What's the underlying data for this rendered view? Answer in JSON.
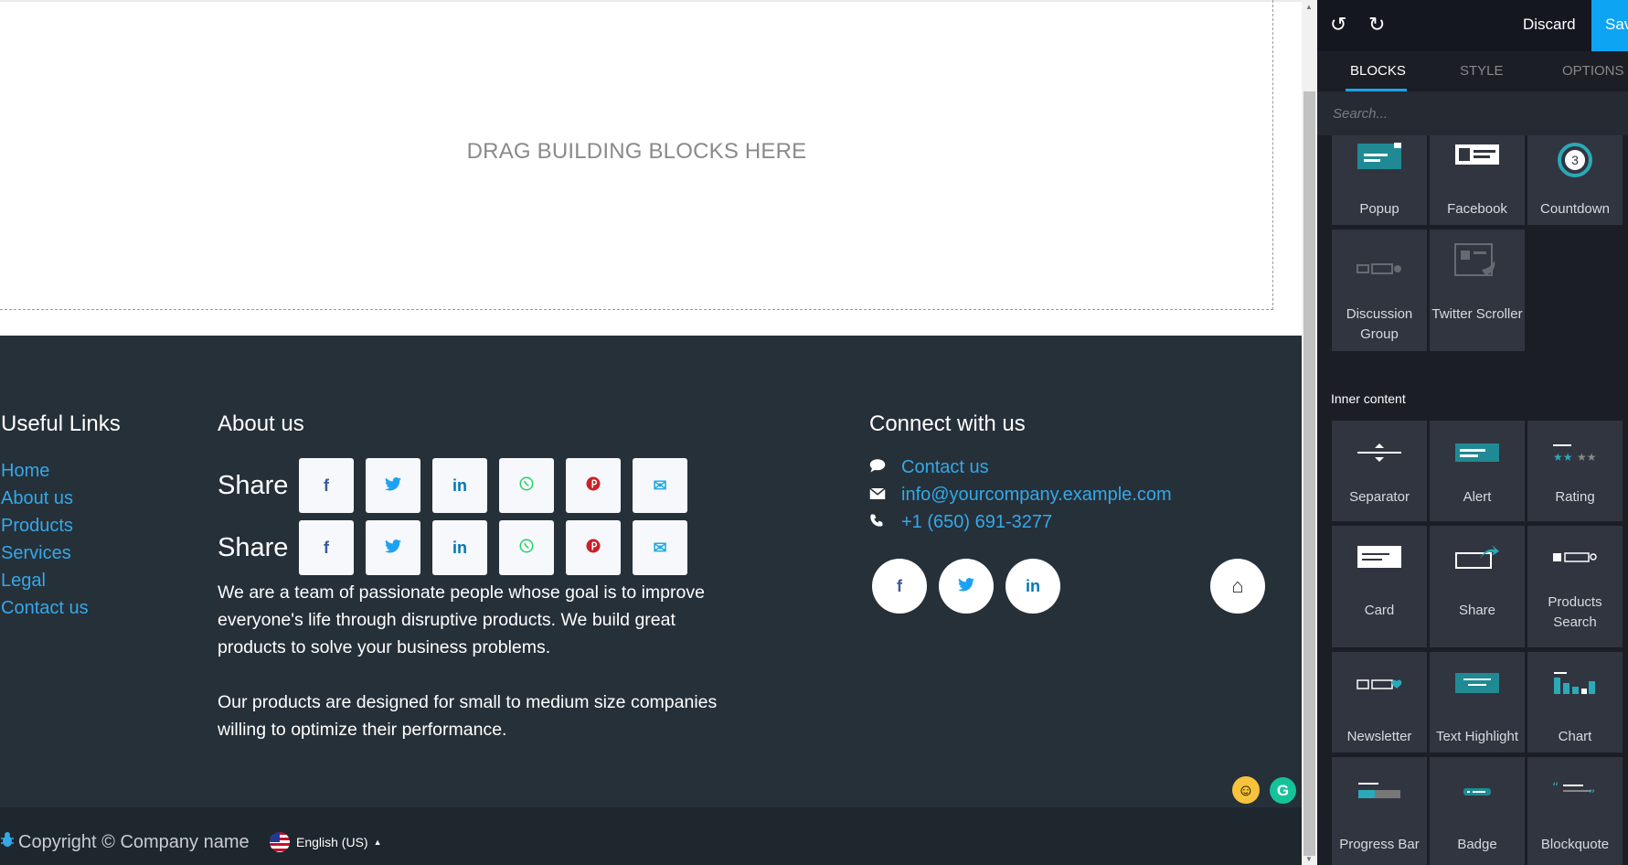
{
  "canvas": {
    "dropzone_text": "DRAG BUILDING BLOCKS HERE"
  },
  "footer": {
    "useful_links": {
      "title": "Useful Links",
      "items": [
        "Home",
        "About us",
        "Products",
        "Services",
        "Legal",
        "Contact us"
      ]
    },
    "about": {
      "title": "About us",
      "share_label": "Share",
      "share_buttons": [
        "f",
        "t",
        "in",
        "w",
        "p",
        "✉"
      ],
      "paragraph1": "We are a team of passionate people whose goal is to improve everyone's life through disruptive products. We build great products to solve your business problems.",
      "paragraph2": "Our products are designed for small to medium size companies willing to optimize their performance."
    },
    "connect": {
      "title": "Connect with us",
      "contact_label": "Contact us",
      "email": "info@yourcompany.example.com",
      "phone": "+1 (650) 691-3277",
      "socials": [
        "f",
        "t",
        "in"
      ],
      "home_glyph": "⌂"
    },
    "copyright": "Copyright © Company name",
    "language": "English (US)"
  },
  "editor": {
    "undo_glyph": "↺",
    "redo_glyph": "↻",
    "discard_label": "Discard",
    "save_label": "Sav",
    "tabs": [
      "BLOCKS",
      "STYLE",
      "OPTIONS"
    ],
    "search_placeholder": "Search...",
    "blocks_top": [
      {
        "label": "Popup",
        "icon": "popup-icon"
      },
      {
        "label": "Facebook",
        "icon": "facebook-block-icon"
      },
      {
        "label": "Countdown",
        "icon": "countdown-icon",
        "countdown_value": "3"
      },
      {
        "label": "Discussion Group",
        "icon": "discussion-group-icon"
      },
      {
        "label": "Twitter Scroller",
        "icon": "twitter-scroller-icon"
      }
    ],
    "inner_content_label": "Inner content",
    "blocks_inner": [
      {
        "label": "Separator",
        "icon": "separator-icon"
      },
      {
        "label": "Alert",
        "icon": "alert-icon"
      },
      {
        "label": "Rating",
        "icon": "rating-icon"
      },
      {
        "label": "Card",
        "icon": "card-icon"
      },
      {
        "label": "Share",
        "icon": "share-icon"
      },
      {
        "label": "Products Search",
        "icon": "products-search-icon"
      },
      {
        "label": "Newsletter",
        "icon": "newsletter-icon"
      },
      {
        "label": "Text Highlight",
        "icon": "text-highlight-icon"
      },
      {
        "label": "Chart",
        "icon": "chart-icon"
      },
      {
        "label": "Progress Bar",
        "icon": "progress-bar-icon"
      },
      {
        "label": "Badge",
        "icon": "badge-icon"
      },
      {
        "label": "Blockquote",
        "icon": "blockquote-icon"
      }
    ]
  },
  "colors": {
    "footer_bg": "#263039",
    "link": "#35a8e8",
    "accent": "#0ea4f4",
    "panel_bg": "#1b1e25",
    "facebook": "#3b5998",
    "twitter": "#1da1f2",
    "linkedin": "#0077b5",
    "whatsapp": "#25d366",
    "pinterest": "#cb2027",
    "email": "#27a9e1"
  }
}
